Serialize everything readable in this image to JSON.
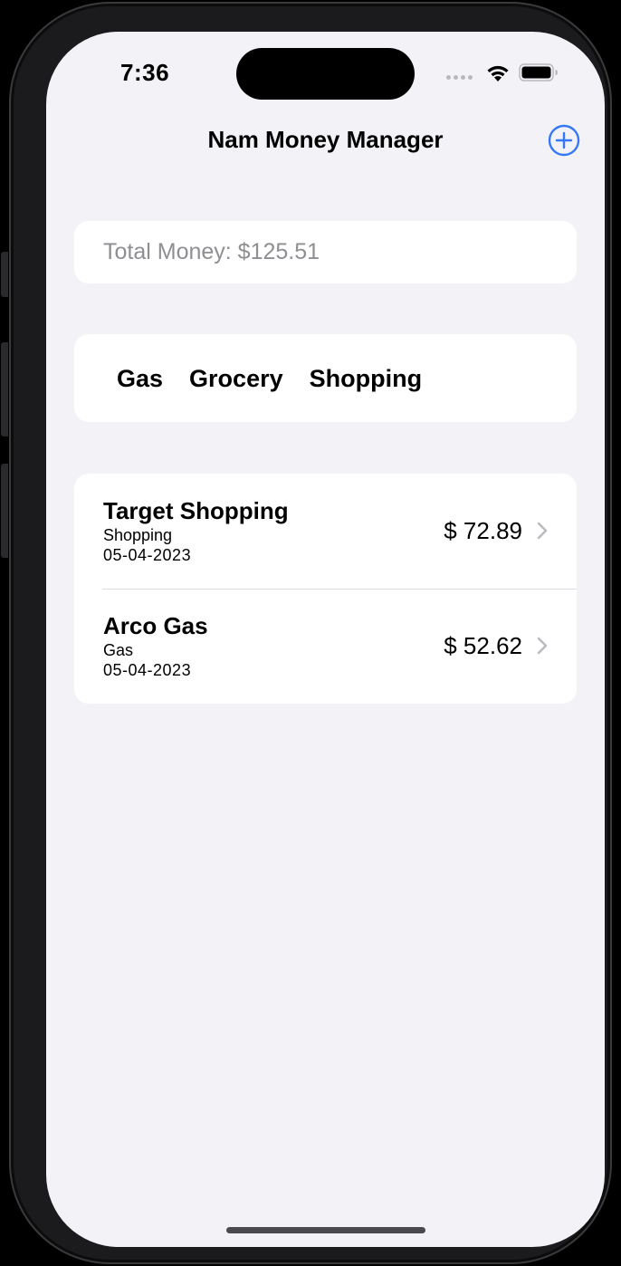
{
  "status_bar": {
    "time": "7:36"
  },
  "nav": {
    "title": "Nam Money Manager",
    "add_icon": "plus-circle-icon",
    "accent_color": "#3478f6"
  },
  "total": {
    "text": "Total Money: $125.51"
  },
  "categories": [
    {
      "label": "Gas"
    },
    {
      "label": "Grocery"
    },
    {
      "label": "Shopping"
    }
  ],
  "transactions": [
    {
      "name": "Target Shopping",
      "category": "Shopping",
      "date": "05-04-2023",
      "amount": "$ 72.89"
    },
    {
      "name": "Arco Gas",
      "category": "Gas",
      "date": "05-04-2023",
      "amount": "$ 52.62"
    }
  ]
}
